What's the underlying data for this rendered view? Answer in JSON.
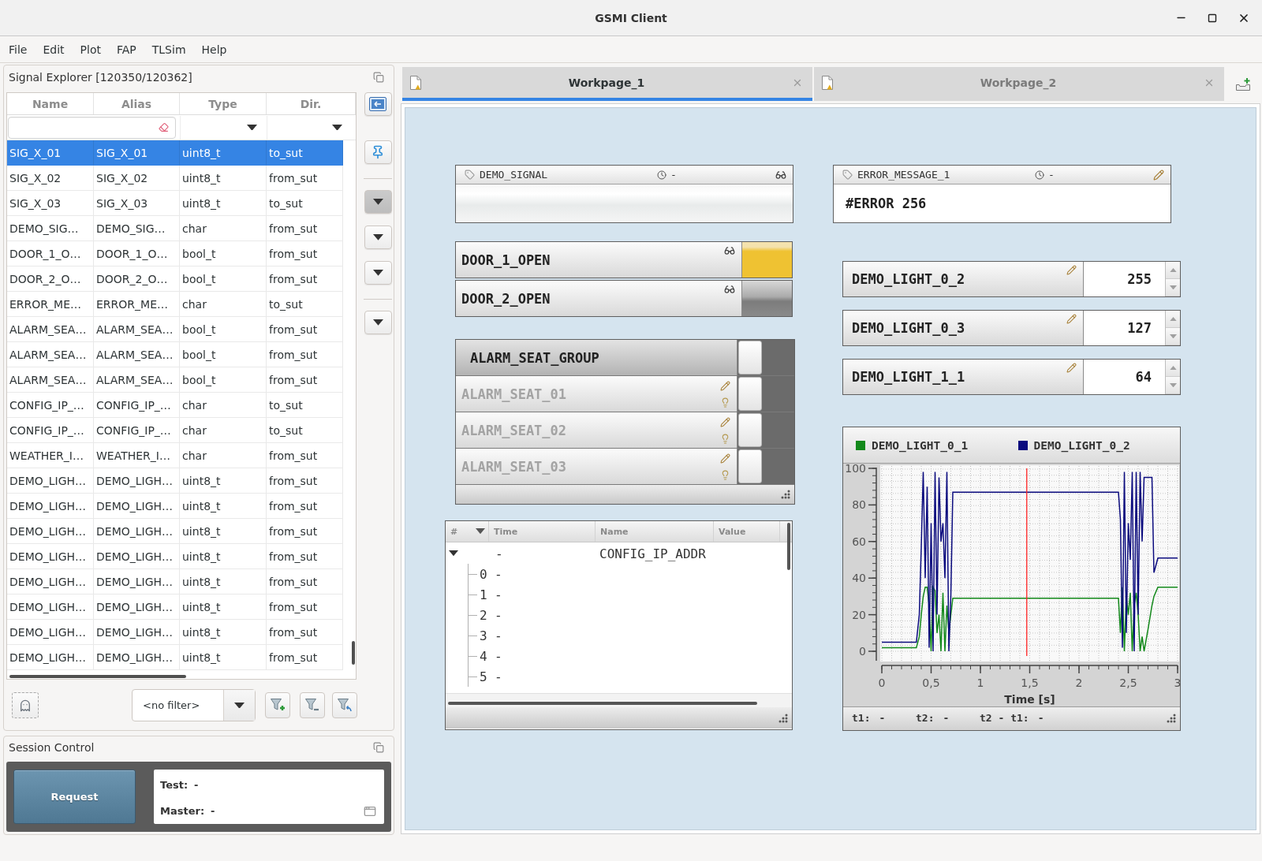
{
  "window": {
    "title": "GSMI Client"
  },
  "menu": [
    "File",
    "Edit",
    "Plot",
    "FAP",
    "TLSim",
    "Help"
  ],
  "signal_explorer": {
    "title": "Signal Explorer [120350/120362]",
    "columns": [
      "Name",
      "Alias",
      "Type",
      "Dir."
    ],
    "rows": [
      {
        "name": "SIG_X_01",
        "alias": "SIG_X_01",
        "type": "uint8_t",
        "dir": "to_sut",
        "selected": true
      },
      {
        "name": "SIG_X_02",
        "alias": "SIG_X_02",
        "type": "uint8_t",
        "dir": "from_sut",
        "selected": false
      },
      {
        "name": "SIG_X_03",
        "alias": "SIG_X_03",
        "type": "uint8_t",
        "dir": "to_sut",
        "selected": false
      },
      {
        "name": "DEMO_SIG…",
        "alias": "DEMO_SIG…",
        "type": "char",
        "dir": "from_sut",
        "selected": false
      },
      {
        "name": "DOOR_1_O…",
        "alias": "DOOR_1_O…",
        "type": "bool_t",
        "dir": "from_sut",
        "selected": false
      },
      {
        "name": "DOOR_2_O…",
        "alias": "DOOR_2_O…",
        "type": "bool_t",
        "dir": "from_sut",
        "selected": false
      },
      {
        "name": "ERROR_ME…",
        "alias": "ERROR_ME…",
        "type": "char",
        "dir": "to_sut",
        "selected": false
      },
      {
        "name": "ALARM_SEA…",
        "alias": "ALARM_SEA…",
        "type": "bool_t",
        "dir": "from_sut",
        "selected": false
      },
      {
        "name": "ALARM_SEA…",
        "alias": "ALARM_SEA…",
        "type": "bool_t",
        "dir": "from_sut",
        "selected": false
      },
      {
        "name": "ALARM_SEA…",
        "alias": "ALARM_SEA…",
        "type": "bool_t",
        "dir": "from_sut",
        "selected": false
      },
      {
        "name": "CONFIG_IP_…",
        "alias": "CONFIG_IP_…",
        "type": "char",
        "dir": "to_sut",
        "selected": false
      },
      {
        "name": "CONFIG_IP_…",
        "alias": "CONFIG_IP_…",
        "type": "char",
        "dir": "to_sut",
        "selected": false
      },
      {
        "name": "WEATHER_I…",
        "alias": "WEATHER_I…",
        "type": "char",
        "dir": "from_sut",
        "selected": false
      },
      {
        "name": "DEMO_LIGH…",
        "alias": "DEMO_LIGH…",
        "type": "uint8_t",
        "dir": "from_sut",
        "selected": false
      },
      {
        "name": "DEMO_LIGH…",
        "alias": "DEMO_LIGH…",
        "type": "uint8_t",
        "dir": "from_sut",
        "selected": false
      },
      {
        "name": "DEMO_LIGH…",
        "alias": "DEMO_LIGH…",
        "type": "uint8_t",
        "dir": "from_sut",
        "selected": false
      },
      {
        "name": "DEMO_LIGH…",
        "alias": "DEMO_LIGH…",
        "type": "uint8_t",
        "dir": "from_sut",
        "selected": false
      },
      {
        "name": "DEMO_LIGH…",
        "alias": "DEMO_LIGH…",
        "type": "uint8_t",
        "dir": "from_sut",
        "selected": false
      },
      {
        "name": "DEMO_LIGH…",
        "alias": "DEMO_LIGH…",
        "type": "uint8_t",
        "dir": "from_sut",
        "selected": false
      },
      {
        "name": "DEMO_LIGH…",
        "alias": "DEMO_LIGH…",
        "type": "uint8_t",
        "dir": "from_sut",
        "selected": false
      },
      {
        "name": "DEMO_LIGH…",
        "alias": "DEMO_LIGH…",
        "type": "uint8_t",
        "dir": "from_sut",
        "selected": false
      }
    ],
    "side_toolbar": [
      [
        {
          "kind": "view",
          "pressed": false
        },
        {
          "kind": "pin",
          "pressed": false
        }
      ],
      [
        {
          "kind": "menu",
          "pressed": true
        },
        {
          "kind": "menu",
          "pressed": false
        },
        {
          "kind": "menu",
          "pressed": false
        }
      ],
      [
        {
          "kind": "menu",
          "pressed": false
        }
      ]
    ],
    "filter": {
      "value": "<no filter>"
    }
  },
  "session_control": {
    "title": "Session Control",
    "button": "Request",
    "fields": [
      {
        "label": "Test:",
        "value": "-"
      },
      {
        "label": "Master:",
        "value": "-"
      }
    ]
  },
  "tabs": [
    {
      "label": "Workpage_1",
      "selected": true
    },
    {
      "label": "Workpage_2",
      "selected": false
    }
  ],
  "workpage": {
    "left": [
      {
        "kind": "display",
        "name": "DEMO_SIGNAL",
        "time": "-",
        "editable": false
      },
      {
        "kind": "lamp",
        "name": "DOOR_1_OPEN",
        "on": true
      },
      {
        "kind": "lamp",
        "name": "DOOR_2_OPEN",
        "on": false
      },
      {
        "kind": "group",
        "name": "ALARM_SEAT_GROUP",
        "on": false,
        "children": [
          {
            "name": "ALARM_SEAT_01",
            "on": false,
            "disabled": true
          },
          {
            "name": "ALARM_SEAT_02",
            "on": false,
            "disabled": true
          },
          {
            "name": "ALARM_SEAT_03",
            "on": false,
            "disabled": true
          }
        ]
      },
      {
        "kind": "log",
        "columns": [
          "#",
          "Time",
          "Name",
          "Value"
        ],
        "rows": [
          {
            "time": "-",
            "name": "CONFIG_IP_ADDR",
            "expanded": true,
            "children": [
              {
                "index": "0",
                "time": "-"
              },
              {
                "index": "1",
                "time": "-"
              },
              {
                "index": "2",
                "time": "-"
              },
              {
                "index": "3",
                "time": "-"
              },
              {
                "index": "4",
                "time": "-"
              },
              {
                "index": "5",
                "time": "-"
              }
            ]
          }
        ]
      }
    ],
    "right": [
      {
        "kind": "display",
        "name": "ERROR_MESSAGE_1",
        "time": "-",
        "value": "#ERROR 256",
        "editable": true
      },
      {
        "kind": "number",
        "name": "DEMO_LIGHT_0_2",
        "value": "255"
      },
      {
        "kind": "number",
        "name": "DEMO_LIGHT_0_3",
        "value": "127"
      },
      {
        "kind": "number",
        "name": "DEMO_LIGHT_1_1",
        "value": "64"
      },
      {
        "kind": "plot",
        "chart_data": {
          "type": "line",
          "xlabel": "Time [s]",
          "xlim": [
            0,
            3
          ],
          "ylim": [
            0,
            100
          ],
          "grid": true,
          "xticks": [
            {
              "value": 0,
              "label": "0"
            },
            {
              "value": 0.5,
              "label": "0,5"
            },
            {
              "value": 1,
              "label": "1"
            },
            {
              "value": 1.5,
              "label": "1,5"
            },
            {
              "value": 2,
              "label": "2"
            },
            {
              "value": 2.5,
              "label": "2,5"
            },
            {
              "value": 3,
              "label": "3"
            }
          ],
          "yticks": [
            0,
            20,
            40,
            60,
            80,
            100
          ],
          "x": [
            0,
            0.35,
            0.38,
            0.4,
            0.42,
            0.44,
            0.46,
            0.48,
            0.5,
            0.52,
            0.54,
            0.56,
            0.58,
            0.6,
            0.62,
            0.64,
            0.66,
            0.68,
            0.7,
            0.72,
            1,
            1.5,
            2,
            2.4,
            2.42,
            2.44,
            2.46,
            2.48,
            2.5,
            2.52,
            2.54,
            2.56,
            2.58,
            2.6,
            2.62,
            2.64,
            2.66,
            2.7,
            2.74,
            2.76,
            2.8,
            3
          ],
          "series": [
            {
              "name": "DEMO_LIGHT_0_1",
              "color": "#13891b",
              "values": [
                2,
                2,
                8,
                20,
                30,
                35,
                35,
                25,
                0,
                35,
                33,
                10,
                20,
                0,
                32,
                0,
                25,
                10,
                20,
                29,
                29,
                29,
                29,
                29,
                10,
                35,
                0,
                30,
                20,
                32,
                0,
                25,
                32,
                20,
                0,
                8,
                0,
                12,
                25,
                30,
                35,
                35
              ]
            },
            {
              "name": "DEMO_LIGHT_0_2",
              "color": "#0b0b7e",
              "values": [
                5,
                5,
                20,
                57,
                98,
                40,
                90,
                2,
                70,
                0,
                98,
                20,
                95,
                60,
                70,
                40,
                98,
                0,
                30,
                87,
                87,
                87,
                87,
                87,
                72,
                2,
                98,
                10,
                70,
                50,
                98,
                0,
                98,
                20,
                98,
                60,
                95,
                95,
                95,
                43,
                51,
                51
              ]
            }
          ],
          "ref_lines": [
            {
              "axis": "x",
              "value": 1.47,
              "color": "#ff2424"
            }
          ]
        },
        "cursors": [
          {
            "label": "t1:",
            "value": "-"
          },
          {
            "label": "t2:",
            "value": "-"
          },
          {
            "label": "t2 - t1:",
            "value": "-"
          }
        ]
      }
    ]
  }
}
